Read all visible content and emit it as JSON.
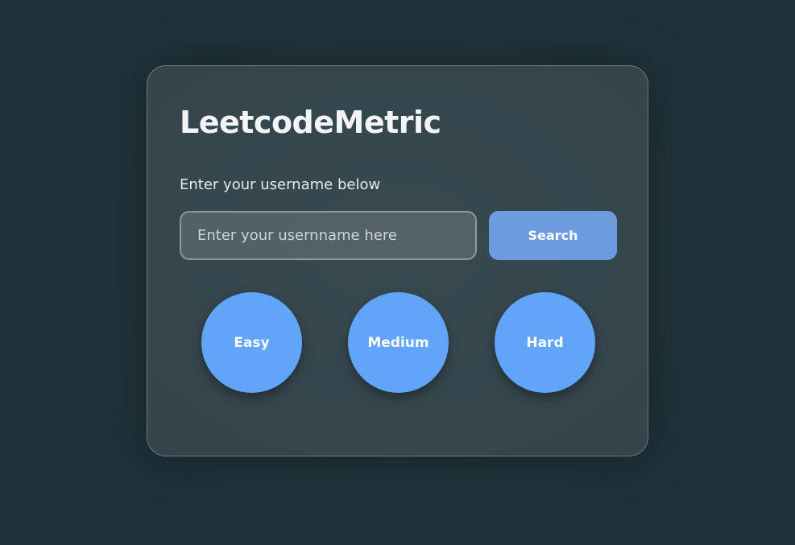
{
  "app": {
    "title": "LeetcodeMetric"
  },
  "form": {
    "subtitle": "Enter your username below",
    "input_placeholder": "Enter your usernname here",
    "input_value": "",
    "search_label": "Search"
  },
  "progress": {
    "items": [
      {
        "label": "Easy"
      },
      {
        "label": "Medium"
      },
      {
        "label": "Hard"
      }
    ]
  },
  "colors": {
    "background": "#1f323a",
    "button": "#6c9be0",
    "circle": "#61a5fb",
    "text": "#f2f4f5"
  }
}
